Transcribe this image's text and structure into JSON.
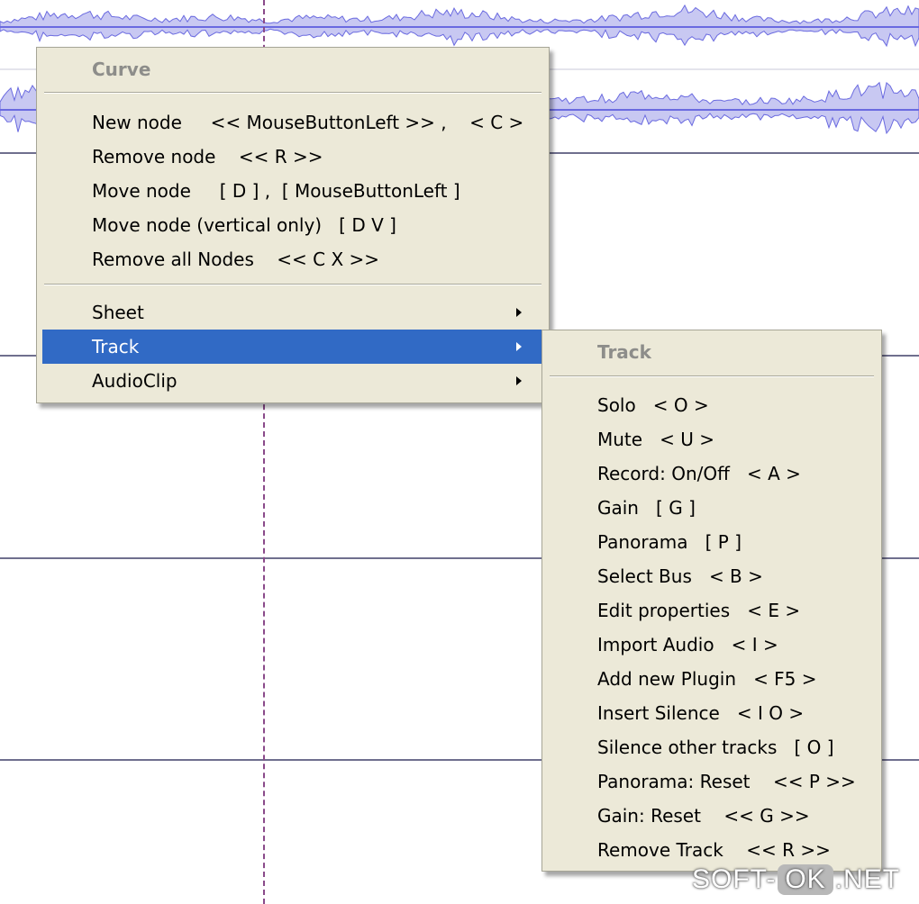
{
  "curve_menu": {
    "title": "Curve",
    "node_items": [
      "New node     << MouseButtonLeft >> ,    < C >",
      "Remove node    << R >>",
      "Move node     [ D ] ,  [ MouseButtonLeft ]",
      "Move node (vertical only)   [ D V ]",
      "Remove all Nodes    << C X >>"
    ],
    "submenus": [
      {
        "label": "Sheet",
        "selected": false
      },
      {
        "label": "Track",
        "selected": true
      },
      {
        "label": "AudioClip",
        "selected": false
      }
    ]
  },
  "track_menu": {
    "title": "Track",
    "items": [
      "Solo   < O >",
      "Mute   < U >",
      "Record: On/Off   < A >",
      "Gain   [ G ]",
      "Panorama   [ P ]",
      "Select Bus   < B >",
      "Edit properties   < E >",
      "Import Audio   < I >",
      "Add new Plugin   < F5 >",
      "Insert Silence   < I O >",
      "Silence other tracks   [ O ]",
      "Panorama: Reset    << P >>",
      "Gain: Reset    << G >>",
      "Remove Track    << R >>"
    ]
  },
  "watermark": {
    "left": "SOFT-",
    "badge": "OK",
    "right": ".NET"
  },
  "colors": {
    "menu_bg": "#ece9d8",
    "selection": "#316ac5",
    "waveform_fill": "#c8c8f2",
    "waveform_stroke": "#6a6ae0",
    "track_line": "#6f6f8e",
    "cursor": "#8a4a8a"
  }
}
